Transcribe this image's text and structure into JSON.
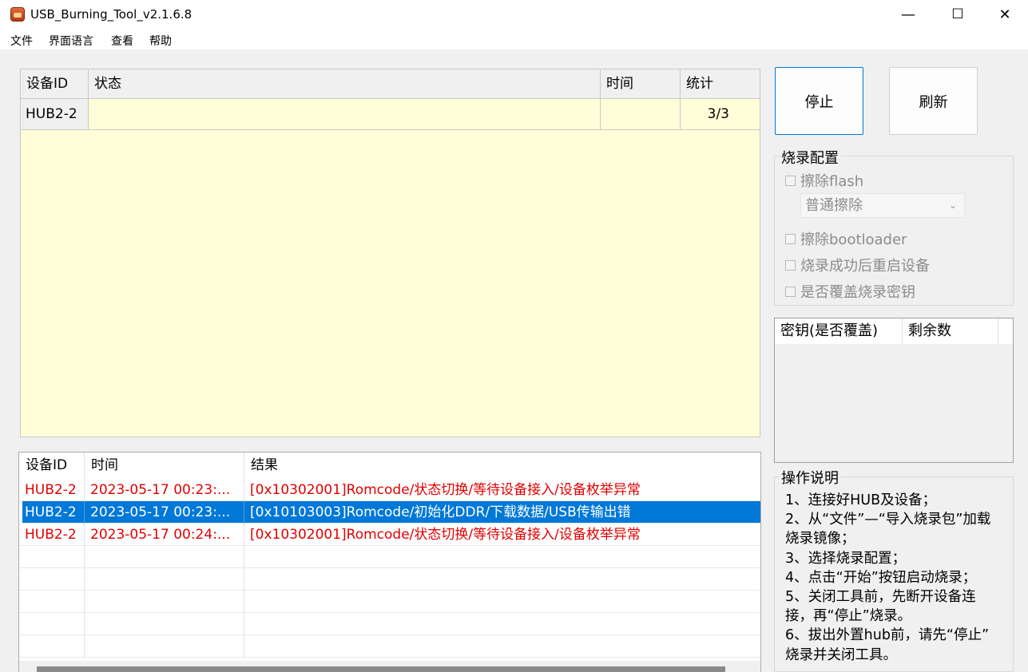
{
  "window": {
    "title": "USB_Burning_Tool_v2.1.6.8",
    "minimize_glyph": "—",
    "maximize_glyph": "☐",
    "close_glyph": "✕"
  },
  "menu": [
    "文件",
    "界面语言",
    "查看",
    "帮助"
  ],
  "device_table": {
    "headers": [
      "设备ID",
      "状态",
      "时间",
      "统计"
    ],
    "rows": [
      {
        "id": "HUB2-2",
        "status": "",
        "time": "",
        "count": "3/3"
      }
    ]
  },
  "log_table": {
    "headers": [
      "设备ID",
      "时间",
      "结果"
    ],
    "rows": [
      {
        "id": "HUB2-2",
        "time": "2023-05-17 00:23:...",
        "result": "[0x10302001]Romcode/状态切换/等待设备接入/设备枚举异常",
        "selected": false
      },
      {
        "id": "HUB2-2",
        "time": "2023-05-17 00:23:...",
        "result": "[0x10103003]Romcode/初始化DDR/下载数据/USB传输出错",
        "selected": true
      },
      {
        "id": "HUB2-2",
        "time": "2023-05-17 00:24:...",
        "result": "[0x10302001]Romcode/状态切换/等待设备接入/设备枚举异常",
        "selected": false
      }
    ]
  },
  "buttons": {
    "stop": "停止",
    "refresh": "刷新"
  },
  "config": {
    "title": "烧录配置",
    "erase_flash": "擦除flash",
    "erase_mode": "普通擦除",
    "erase_bootloader": "擦除bootloader",
    "reboot_after": "烧录成功后重启设备",
    "overwrite_key": "是否覆盖烧录密钥"
  },
  "key_table": {
    "headers": [
      "密钥(是否覆盖)",
      "剩余数"
    ]
  },
  "instructions": {
    "title": "操作说明",
    "lines": [
      "1、连接好HUB及设备；",
      "2、从“文件”—“导入烧录包”加载",
      "烧录镜像；",
      "3、选择烧录配置；",
      "4、点击“开始”按钮启动烧录；",
      "5、关闭工具前，先断开设备连",
      "接，再“停止”烧录。",
      "6、拔出外置hub前，请先“停止”",
      "烧录并关闭工具。"
    ]
  },
  "colors": {
    "selection": "#0078d7",
    "error_text": "#e00000",
    "device_area": "#fffed8"
  }
}
